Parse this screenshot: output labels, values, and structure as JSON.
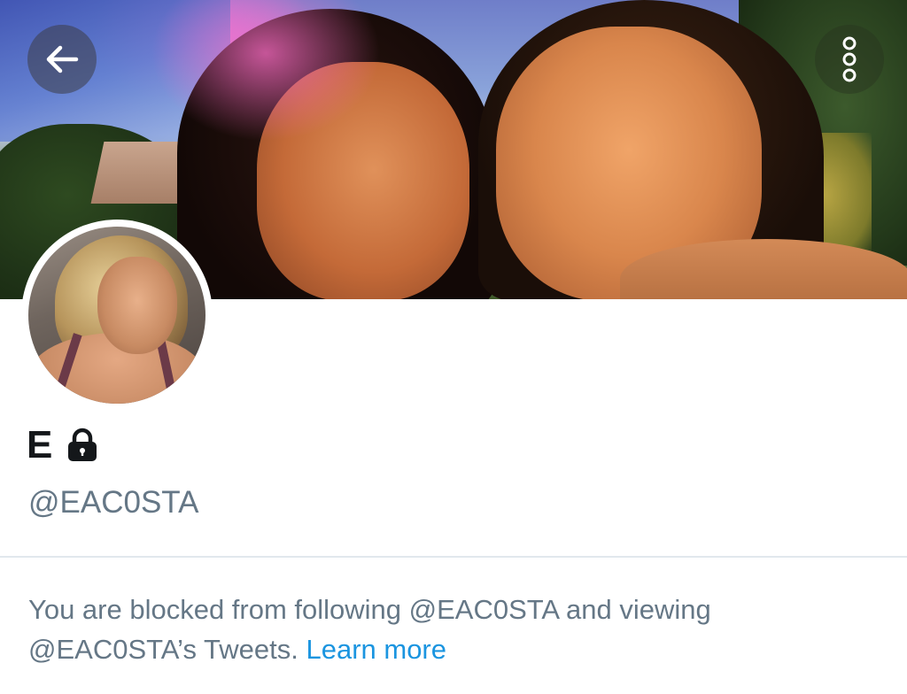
{
  "header": {
    "back_icon": "arrow-left-icon",
    "more_icon": "more-vertical-icon"
  },
  "profile": {
    "display_name": "E",
    "protected_icon": "lock-icon",
    "handle": "@EAC0STA"
  },
  "blocked_notice": {
    "text": "You are blocked from following @EAC0STA and viewing @EAC0STA’s Tweets.",
    "link_label": "Learn more",
    "link_color": "#1b95e0"
  },
  "colors": {
    "primary_text": "#14171a",
    "secondary_text": "#657786",
    "divider": "#e1e8ed"
  }
}
